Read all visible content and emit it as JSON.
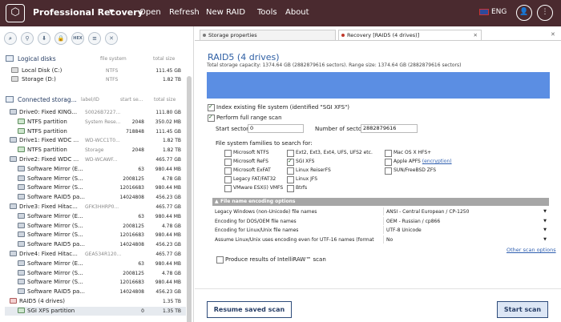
{
  "topbar": {
    "title": "Professional Recovery",
    "caret": "▼",
    "menu": [
      "Open",
      "Refresh",
      "New RAID",
      "Tools",
      "About"
    ],
    "lang": "ENG",
    "logo_icon": "box-icon",
    "colors": {
      "bar": "#4a2a2f",
      "accent": "#5b8ee3",
      "link": "#2f5fb0"
    }
  },
  "toolbar": [
    {
      "name": "scan-icon",
      "glyph": "⌕"
    },
    {
      "name": "search-icon",
      "glyph": "⚲"
    },
    {
      "name": "save-icon",
      "glyph": "⬇"
    },
    {
      "name": "lock-icon",
      "glyph": "🔒"
    },
    {
      "name": "hex-icon",
      "glyph": "HEX"
    },
    {
      "name": "list-icon",
      "glyph": "≡"
    },
    {
      "name": "cancel-icon",
      "glyph": "✕"
    }
  ],
  "left": {
    "logical": {
      "title": "Logical disks",
      "col1": "file system",
      "col2": "total size",
      "rows": [
        {
          "name": "Local Disk (C:)",
          "fs": "NTFS",
          "size": "111.45 GB"
        },
        {
          "name": "Storage (D:)",
          "fs": "NTFS",
          "size": "1.82 TB"
        }
      ]
    },
    "connected": {
      "title": "Connected storag...",
      "col1": "label/ID",
      "col2": "start se...",
      "col3": "total size",
      "rows": [
        {
          "indent": 6,
          "icon": "drive",
          "name": "Drive0: Fixed KING...",
          "id": "50026B7227...",
          "start": "",
          "size": "111.80 GB"
        },
        {
          "indent": 16,
          "icon": "part",
          "name": "NTFS partition",
          "id": "System Rese...",
          "start": "2048",
          "size": "350.02 MB"
        },
        {
          "indent": 16,
          "icon": "part",
          "name": "NTFS partition",
          "id": "",
          "start": "718848",
          "size": "111.45 GB"
        },
        {
          "indent": 6,
          "icon": "drive",
          "name": "Drive1: Fixed WDC ...",
          "id": "WD-WCC1T0...",
          "start": "",
          "size": "1.82 TB"
        },
        {
          "indent": 16,
          "icon": "part",
          "name": "NTFS partition",
          "id": "Storage",
          "start": "2048",
          "size": "1.82 TB"
        },
        {
          "indent": 6,
          "icon": "drive",
          "name": "Drive2: Fixed WDC ...",
          "id": "WD-WCAWF...",
          "start": "",
          "size": "465.77 GB"
        },
        {
          "indent": 16,
          "icon": "mirror",
          "name": "Software Mirror (E...",
          "id": "",
          "start": "63",
          "size": "980.44 MB"
        },
        {
          "indent": 16,
          "icon": "mirror",
          "name": "Software Mirror (S...",
          "id": "",
          "start": "2008125",
          "size": "4.78 GB"
        },
        {
          "indent": 16,
          "icon": "mirror",
          "name": "Software Mirror (S...",
          "id": "",
          "start": "12016683",
          "size": "980.44 MB"
        },
        {
          "indent": 16,
          "icon": "mirror",
          "name": "Software RAID5 pa...",
          "id": "",
          "start": "14024808",
          "size": "456.23 GB"
        },
        {
          "indent": 6,
          "icon": "drive",
          "name": "Drive3: Fixed Hitac...",
          "id": "GFK3HHRP0...",
          "start": "",
          "size": "465.77 GB"
        },
        {
          "indent": 16,
          "icon": "mirror",
          "name": "Software Mirror (E...",
          "id": "",
          "start": "63",
          "size": "980.44 MB"
        },
        {
          "indent": 16,
          "icon": "mirror",
          "name": "Software Mirror (S...",
          "id": "",
          "start": "2008125",
          "size": "4.78 GB"
        },
        {
          "indent": 16,
          "icon": "mirror",
          "name": "Software Mirror (S...",
          "id": "",
          "start": "12016683",
          "size": "980.44 MB"
        },
        {
          "indent": 16,
          "icon": "mirror",
          "name": "Software RAID5 pa...",
          "id": "",
          "start": "14024808",
          "size": "456.23 GB"
        },
        {
          "indent": 6,
          "icon": "drive",
          "name": "Drive4: Fixed Hitac...",
          "id": "GEA534R120...",
          "start": "",
          "size": "465.77 GB"
        },
        {
          "indent": 16,
          "icon": "mirror",
          "name": "Software Mirror (E...",
          "id": "",
          "start": "63",
          "size": "980.44 MB"
        },
        {
          "indent": 16,
          "icon": "mirror",
          "name": "Software Mirror (S...",
          "id": "",
          "start": "2008125",
          "size": "4.78 GB"
        },
        {
          "indent": 16,
          "icon": "mirror",
          "name": "Software Mirror (S...",
          "id": "",
          "start": "12016683",
          "size": "980.44 MB"
        },
        {
          "indent": 16,
          "icon": "mirror",
          "name": "Software RAID5 pa...",
          "id": "",
          "start": "14024808",
          "size": "456.23 GB"
        },
        {
          "indent": 6,
          "icon": "raid",
          "name": "RAID5 (4 drives)",
          "id": "",
          "start": "",
          "size": "1.35 TB"
        },
        {
          "indent": 16,
          "icon": "part",
          "name": "SGI XFS partition",
          "id": "",
          "start": "0",
          "size": "1.35 TB",
          "selected": true
        }
      ]
    }
  },
  "tabs": [
    {
      "label": "Storage properties",
      "dot": "#7a7a7a",
      "closable": false
    },
    {
      "label": "Recovery [RAID5 (4 drives)]",
      "dot": "#c0392b",
      "closable": true
    }
  ],
  "main": {
    "title": "RAID5 (4 drives)",
    "capacity": "Total storage capacity: 1374.64 GB (2882879616 sectors). Range size: 1374.64 GB (2882879616 sectors)",
    "index_fs": "Index existing file system (identified \"SGI XFS\")",
    "full_range": "Perform full range scan",
    "start_label": "Start sector:",
    "start_value": "0",
    "num_label": "Number of sectors:",
    "num_value": "2882879616",
    "families_label": "File system families to search for:",
    "families": [
      {
        "label": "Microsoft NTFS",
        "on": false
      },
      {
        "label": "Ext2, Ext3, Ext4, UFS, UFS2 etc.",
        "on": false
      },
      {
        "label": "Mac OS X HFS+",
        "on": false
      },
      {
        "label": "Microsoft ReFS",
        "on": false
      },
      {
        "label": "SGI XFS",
        "on": true
      },
      {
        "label": "Apple APFS",
        "on": false,
        "link": "(encryption)"
      },
      {
        "label": "Microsoft ExFAT",
        "on": false
      },
      {
        "label": "Linux ReiserFS",
        "on": false
      },
      {
        "label": "SUN/FreeBSD ZFS",
        "on": false
      },
      {
        "label": "Legacy FAT/FAT32",
        "on": false
      },
      {
        "label": "Linux JFS",
        "on": false
      },
      {
        "label": "VMware ESX(i) VMFS",
        "on": false
      },
      {
        "label": "Btrfs",
        "on": false
      }
    ],
    "encoding_header": "File name encoding options",
    "encoding": [
      {
        "k": "Legacy Windows (non-Unicode) file names",
        "v": "ANSI - Central European / CP-1250"
      },
      {
        "k": "Encoding for DOS/OEM file names",
        "v": "OEM - Russian / cp866"
      },
      {
        "k": "Encoding for Linux/Unix file names",
        "v": "UTF-8 Unicode"
      },
      {
        "k": "Assume Linux/Unix uses encoding even for UTF-16 names (format",
        "v": "No"
      }
    ],
    "other_options": "Other scan options",
    "intelliraw": "Produce results of IntelliRAW™ scan",
    "resume_btn": "Resume saved scan",
    "start_btn": "Start scan"
  }
}
